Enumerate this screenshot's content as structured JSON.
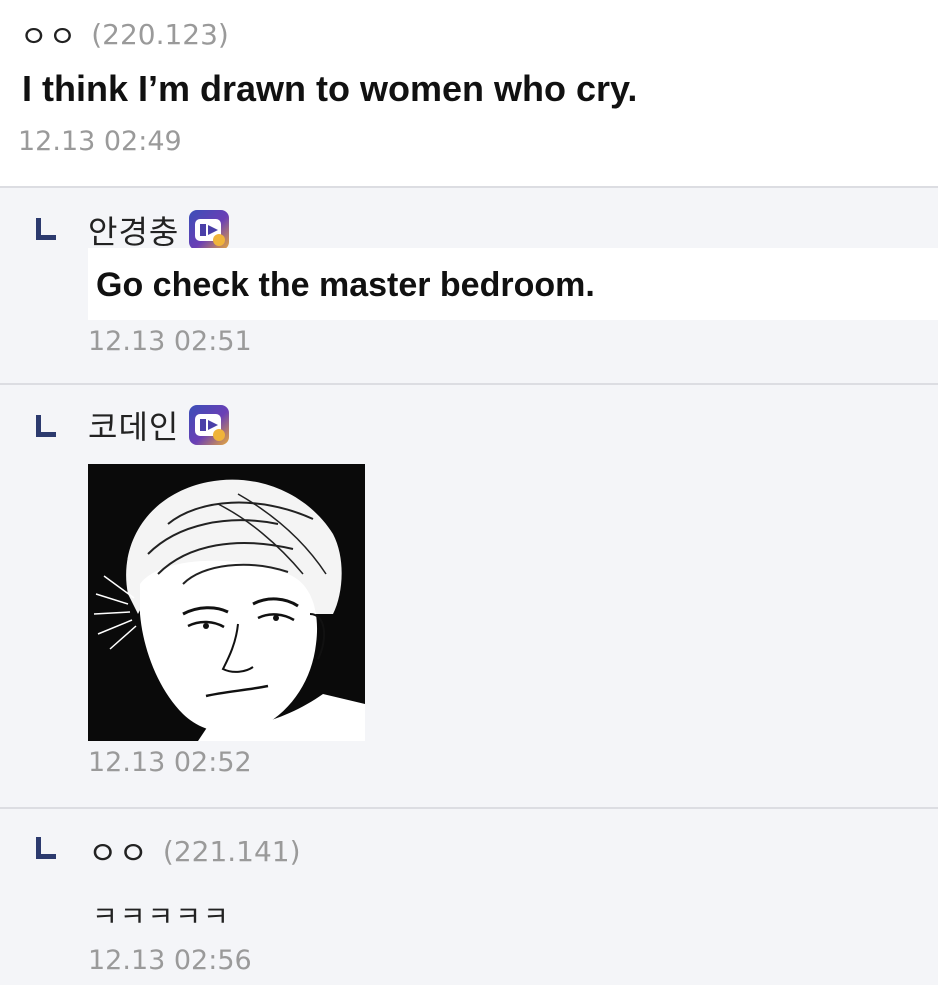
{
  "post": {
    "nickname": "ㅇㅇ",
    "ip": "(220.123)",
    "body": "I think I’m drawn to women who cry.",
    "timestamp": "12.13 02:49"
  },
  "replies": [
    {
      "nickname": "안경충",
      "badge_icon": "fixed-nick-badge-icon",
      "body": "Go check the master bedroom.",
      "timestamp": "12.13 02:51"
    },
    {
      "nickname": "코데인",
      "badge_icon": "fixed-nick-badge-icon",
      "image": "manga-man-sketch",
      "timestamp": "12.13 02:52"
    },
    {
      "nickname": "ㅇㅇ",
      "ip": "(221.141)",
      "body": "ㅋㅋㅋㅋㅋ",
      "timestamp": "12.13 02:56"
    }
  ],
  "colors": {
    "reply_background": "#f4f5f8",
    "divider": "#dcdde2",
    "reply_marker": "#2c3a6e",
    "timestamp": "#9a9a9a"
  }
}
